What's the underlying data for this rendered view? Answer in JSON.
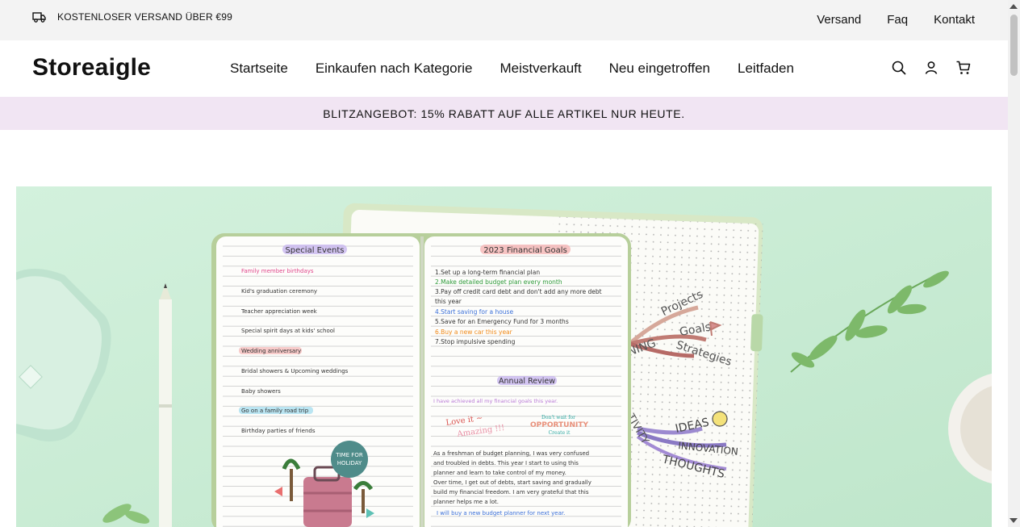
{
  "topbar": {
    "shipping_text": "KOSTENLOSER VERSAND ÜBER €99",
    "shipping_icon": "truck-icon",
    "links": [
      {
        "label": "Versand"
      },
      {
        "label": "Faq"
      },
      {
        "label": "Kontakt"
      }
    ]
  },
  "header": {
    "logo": "Storeaigle",
    "nav": [
      {
        "label": "Startseite"
      },
      {
        "label": "Einkaufen nach Kategorie"
      },
      {
        "label": "Meistverkauft"
      },
      {
        "label": "Neu eingetroffen"
      },
      {
        "label": "Leitfaden"
      }
    ],
    "icons": [
      "search-icon",
      "account-icon",
      "cart-icon"
    ]
  },
  "promo": {
    "text": "BLITZANGEBOT: 15% RABATT AUF ALLE ARTIKEL NUR HEUTE."
  },
  "hero": {
    "left_page": {
      "title": "Special Events",
      "items": [
        "Family member birthdays",
        "Kid's graduation ceremony",
        "Teacher appreciation week",
        "Special spirit days at kids' school",
        "Wedding anniversary",
        "Bridal showers & Upcoming weddings",
        "Baby showers",
        "Go on a family road trip",
        "Birthday parties of friends"
      ],
      "sticker": "TIME FOR HOLIDAY"
    },
    "right_page": {
      "title": "2023 Financial Goals",
      "goals": [
        "1.Set up a long-term financial plan",
        "2.Make detailed budget plan every month",
        "3.Pay off credit card debt and don't add any more debt",
        "this year",
        "4.Start saving for a house",
        "5.Save for an Emergency Fund for 3 months",
        "6.Buy a new car this year",
        "7.Stop impulsive spending"
      ],
      "review_title": "Annual Review",
      "review_line": "I have achieved all my financial goals this year.",
      "love_text": "Love it ~",
      "amazing_text": "Amazing !!!",
      "dont_wait_text": "Don't wait for",
      "opportunity_text": "OPPORTUNITY",
      "create_text": "Create it",
      "paragraph": [
        "As a freshman of budget planning, I was very confused",
        "and troubled in debts. This year I start to using this",
        "planner and learn to take control of my money.",
        "Over time, I get out of debts, start saving and gradually",
        "build my financial freedom. I am very grateful that this",
        "planner helps me a lot."
      ],
      "closing": "I will buy a new budget planner for next year."
    },
    "mindmap": {
      "words": [
        "Projects",
        "Goals",
        "Strategies",
        "NING",
        "TIVITY",
        "IDEAS",
        "INNOVATION",
        "THOUGHTS"
      ]
    },
    "colors": {
      "background": "#cdeed9",
      "highlight_purple": "#c8b6f0",
      "highlight_pink": "#f5b5b5",
      "green_text": "#2e9a3a",
      "blue_text": "#3a6fd8",
      "orange_text": "#f08a1a",
      "pink_text": "#e0458a"
    }
  }
}
